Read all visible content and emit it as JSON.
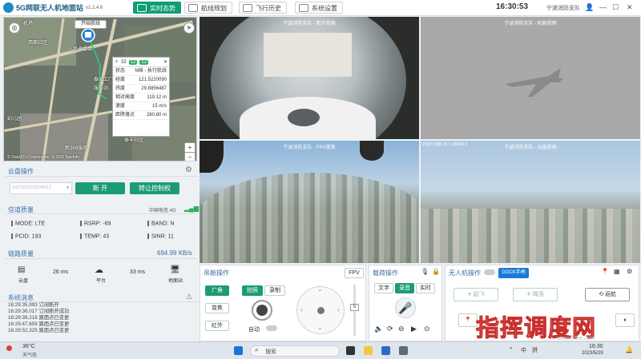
{
  "header": {
    "app_title": "5G网联无人机地面站",
    "version": "v1.2.4.6",
    "tabs": [
      {
        "label": "实时态势"
      },
      {
        "label": "航线规划"
      },
      {
        "label": "飞行历史"
      },
      {
        "label": "系统设置"
      }
    ],
    "clock": "16:30:53",
    "org": "宁波消防支队"
  },
  "map": {
    "labels": {
      "hangar": "机场",
      "start_route": "开始航线",
      "poi1": "人民调委会",
      "poi2": "泰安工厂",
      "poi3": "服务站",
      "poi4": "西面社区",
      "poi5": "幼儿园",
      "poi6": "新369服务",
      "poi7": "泰丰社区",
      "copyright": "© TianDiTu Corporation, © 2021 NavInfo"
    },
    "drone_badge": "32",
    "sat1": "12",
    "sat2": "12",
    "info": [
      {
        "k": "状态",
        "v": "N档 - 执行航线"
      },
      {
        "k": "经度",
        "v": "121.5220090"
      },
      {
        "k": "纬度",
        "v": "29.8856487"
      },
      {
        "k": "相对高度",
        "v": "119.12 m"
      },
      {
        "k": "速度",
        "v": "15 m/s"
      },
      {
        "k": "距降落点",
        "v": "280.80 m"
      }
    ]
  },
  "gimbal": {
    "title": "云盘操作",
    "device": "M2022022804012",
    "disconnect": "断 开",
    "transfer": "转让控制权"
  },
  "signal": {
    "title": "信道质量",
    "carrier": "中国电信 4G",
    "items": [
      {
        "label": "MODE: LTE"
      },
      {
        "label": "RSRP: -69"
      },
      {
        "label": "BAND: N"
      },
      {
        "label": "PCID: 193"
      },
      {
        "label": "TEMP: 43"
      },
      {
        "label": "SINR: 11"
      }
    ]
  },
  "link": {
    "title": "链路质量",
    "rate": "694.99 KB/s",
    "lat1": "26 ms",
    "lat2": "33 ms",
    "node1": "云盘",
    "node2": "平台",
    "node3": "地面站"
  },
  "messages": {
    "title": "系统消息",
    "items": [
      "16:29:35,993 订阅断开",
      "16:29:36,017 订阅断开成功",
      "16:29:38,218 路面点已变更",
      "16:29:47,659 路面点已变更",
      "16:29:52,325 路面点已变更"
    ]
  },
  "videos": {
    "v1": "宁波消防支队 - 航外视频",
    "v2": "宁波消防支队 - 机舱视频",
    "v3": "宁波消防支队 - FPV视频",
    "v4": "宁波消防支队 - 云盘视频",
    "v4_info": "1920*1080 28.7 1000% 0"
  },
  "camera": {
    "title": "吊舱操作",
    "mode": "FPV",
    "wide": "广角",
    "photo": "拍照",
    "record": "录制",
    "zoom": "变焦",
    "ir": "红外",
    "auto": "自动",
    "zoom_val": "5"
  },
  "payload": {
    "title": "载荷操作",
    "text": "文字",
    "audio": "录音",
    "live": "实时"
  },
  "uav": {
    "title": "无人机操作",
    "dock": "DOCK手柄",
    "takeoff": "起飞",
    "land": "降落",
    "return": "返航"
  },
  "taskbar": {
    "weather": "36°C",
    "weather_sub": "天气热",
    "search": "搜索",
    "ime1": "中",
    "ime2": "拼",
    "time": "16:30",
    "date": "2023/5/29"
  },
  "watermark": {
    "text": "指挥调度网",
    "url": "www.94ee.com"
  }
}
